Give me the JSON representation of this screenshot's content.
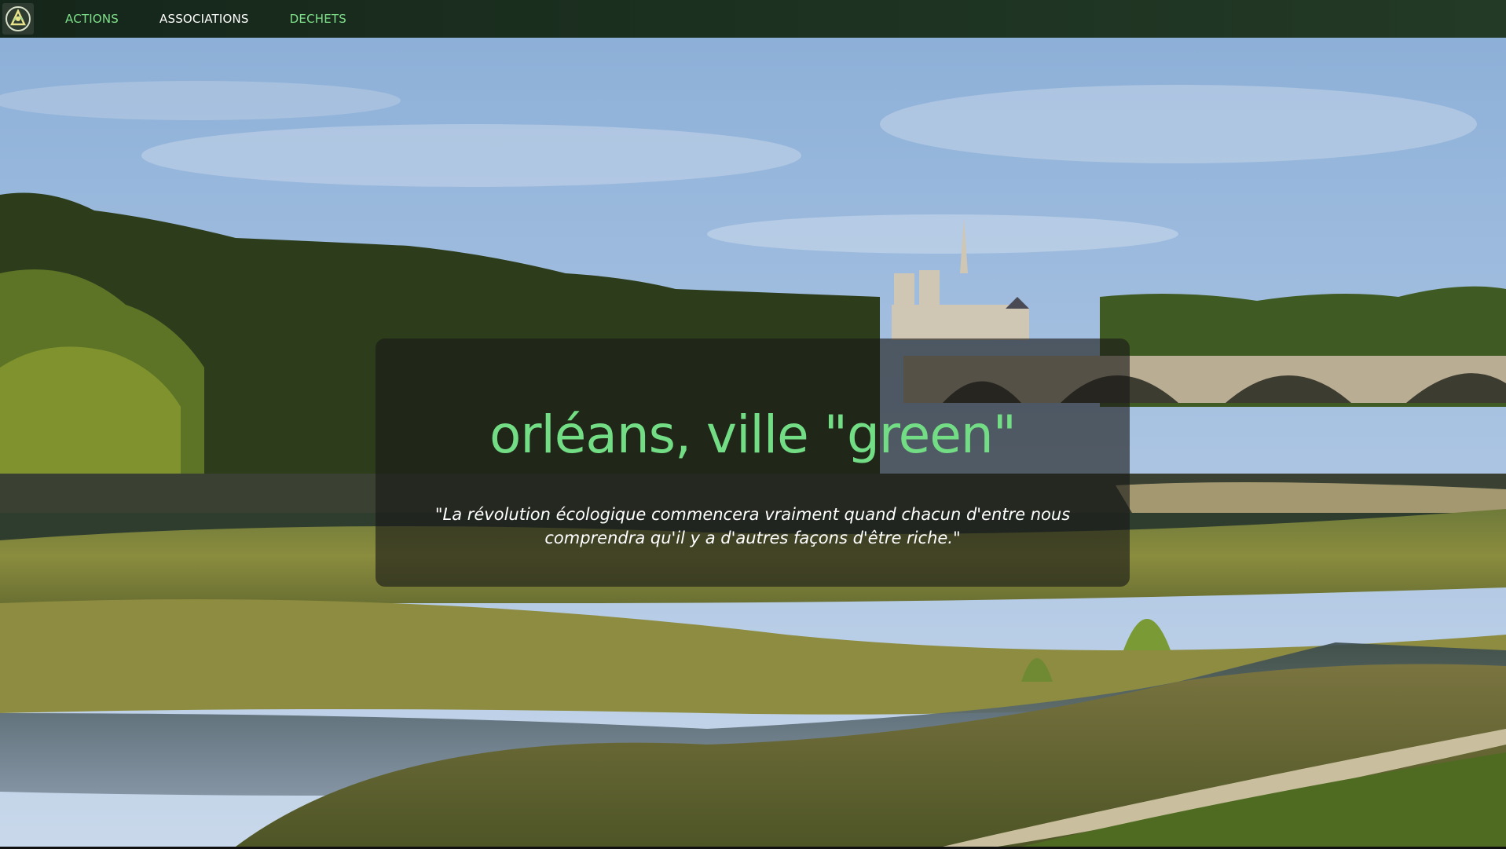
{
  "navbar": {
    "logo_icon": "recycle-leaf-logo-icon",
    "links": [
      {
        "label": "ACTIONS",
        "color": "#7fe08a"
      },
      {
        "label": "ASSOCIATIONS",
        "color": "#ffffff"
      },
      {
        "label": "DECHETS",
        "color": "#7fe08a"
      }
    ]
  },
  "hero": {
    "background": "Loire river landscape with cathedral and stone bridge",
    "title": "orléans, ville \"green\"",
    "quote_line1": "\"La révolution écologique commencera vraiment quand chacun d'entre nous",
    "quote_line2": "comprendra qu'il y a d'autres façons d'être riche.\"",
    "title_color": "#72dd84"
  }
}
